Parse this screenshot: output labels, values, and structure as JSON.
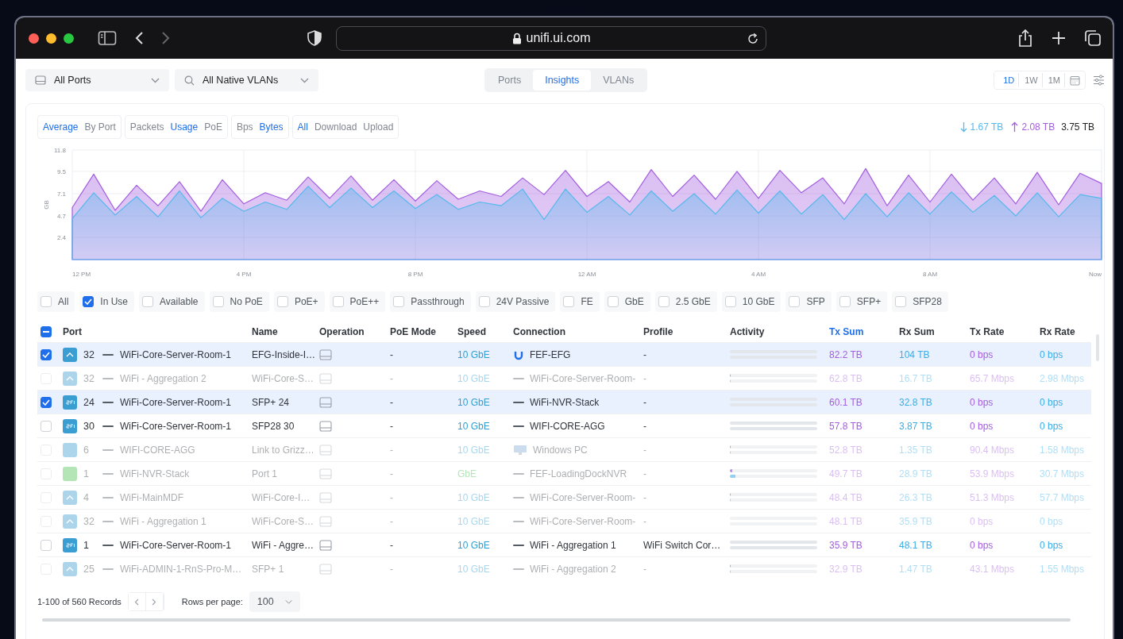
{
  "browser": {
    "url": "unifi.ui.com"
  },
  "filters": {
    "ports": "All Ports",
    "vlans": "All Native VLANs"
  },
  "view_tabs": [
    {
      "label": "Ports",
      "selected": false
    },
    {
      "label": "Insights",
      "selected": true
    },
    {
      "label": "VLANs",
      "selected": false
    }
  ],
  "ranges": [
    {
      "label": "1D",
      "selected": true
    },
    {
      "label": "1W",
      "selected": false
    },
    {
      "label": "1M",
      "selected": false
    }
  ],
  "toggle_groups": [
    {
      "options": [
        {
          "label": "Average",
          "selected": true
        },
        {
          "label": "By Port",
          "selected": false
        }
      ]
    },
    {
      "options": [
        {
          "label": "Packets",
          "selected": false
        },
        {
          "label": "Usage",
          "selected": true
        },
        {
          "label": "PoE",
          "selected": false
        }
      ]
    },
    {
      "options": [
        {
          "label": "Bps",
          "selected": false
        },
        {
          "label": "Bytes",
          "selected": true
        }
      ]
    },
    {
      "options": [
        {
          "label": "All",
          "selected": true
        },
        {
          "label": "Download",
          "selected": false
        },
        {
          "label": "Upload",
          "selected": false
        }
      ]
    }
  ],
  "totals": {
    "download": "1.67 TB",
    "upload": "2.08 TB",
    "total": "3.75 TB"
  },
  "chart_data": {
    "type": "area",
    "ylabel": "GB",
    "stacked": false,
    "grid": true,
    "ylim": [
      0,
      11.8
    ],
    "yticks": [
      2.4,
      4.7,
      7.1,
      9.5,
      11.8
    ],
    "categories": [
      "12 PM",
      null,
      null,
      null,
      null,
      null,
      null,
      null,
      "4 PM",
      null,
      null,
      null,
      null,
      null,
      null,
      null,
      "8 PM",
      null,
      null,
      null,
      null,
      null,
      null,
      null,
      "12 AM",
      null,
      null,
      null,
      null,
      null,
      null,
      null,
      "4 AM",
      null,
      null,
      null,
      null,
      null,
      null,
      null,
      "8 AM",
      null,
      null,
      null,
      null,
      null,
      null,
      null,
      "Now"
    ],
    "series": [
      {
        "color": "#56b9ec",
        "values": [
          4.4,
          7.2,
          4.8,
          6.8,
          4.6,
          7.4,
          4.5,
          6.6,
          5.2,
          6.2,
          5.4,
          7.9,
          5.6,
          7.7,
          5.6,
          7.4,
          5.5,
          7.0,
          5.4,
          6.2,
          5.8,
          7.6,
          4.3,
          7.6,
          5.1,
          6.8,
          4.8,
          7.4,
          5.2,
          7.1,
          4.9,
          7.5,
          5.0,
          7.4,
          4.9,
          7.0,
          4.3,
          7.1,
          4.6,
          7.2,
          4.9,
          7.3,
          5.1,
          6.9,
          4.7,
          7.2,
          4.6,
          7.0,
          6.6
        ]
      },
      {
        "color": "#a35ee0",
        "values": [
          5.6,
          9.2,
          5.3,
          8.0,
          5.8,
          8.4,
          5.2,
          8.6,
          6.0,
          7.2,
          6.4,
          8.9,
          6.6,
          9.0,
          6.4,
          8.6,
          6.3,
          8.5,
          6.5,
          7.4,
          6.8,
          8.8,
          7.0,
          9.6,
          6.8,
          8.4,
          6.2,
          9.7,
          6.8,
          9.1,
          6.5,
          9.5,
          6.6,
          9.6,
          7.2,
          8.8,
          6.0,
          9.8,
          5.8,
          9.1,
          6.2,
          9.2,
          6.4,
          8.8,
          6.0,
          9.4,
          5.9,
          9.3,
          8.2
        ]
      }
    ]
  },
  "port_filters": [
    {
      "label": "All",
      "checked": false
    },
    {
      "label": "In Use",
      "checked": true
    },
    {
      "label": "Available",
      "checked": false
    },
    {
      "label": "No PoE",
      "checked": false
    },
    {
      "label": "PoE+",
      "checked": false
    },
    {
      "label": "PoE++",
      "checked": false
    },
    {
      "label": "Passthrough",
      "checked": false
    },
    {
      "label": "24V Passive",
      "checked": false
    },
    {
      "label": "FE",
      "checked": false
    },
    {
      "label": "GbE",
      "checked": false
    },
    {
      "label": "2.5 GbE",
      "checked": false
    },
    {
      "label": "10 GbE",
      "checked": false
    },
    {
      "label": "SFP",
      "checked": false
    },
    {
      "label": "SFP+",
      "checked": false
    },
    {
      "label": "SFP28",
      "checked": false
    }
  ],
  "table": {
    "select_all": {
      "indeterminate": true
    },
    "columns": [
      {
        "label": "Port",
        "sorted": false
      },
      {
        "label": "Name",
        "sorted": false
      },
      {
        "label": "Operation",
        "sorted": false
      },
      {
        "label": "PoE Mode",
        "sorted": false
      },
      {
        "label": "Speed",
        "sorted": false
      },
      {
        "label": "Connection",
        "sorted": false
      },
      {
        "label": "Profile",
        "sorted": false
      },
      {
        "label": "Activity",
        "sorted": false
      },
      {
        "label": "Tx Sum",
        "sorted": true
      },
      {
        "label": "Rx Sum",
        "sorted": false
      },
      {
        "label": "Tx Rate",
        "sorted": false
      },
      {
        "label": "Rx Rate",
        "sorted": false
      }
    ],
    "rows": [
      {
        "selected": true,
        "disabled": false,
        "port_icon": {
          "kind": "uplink",
          "color": "#3b9ed3"
        },
        "port": "32",
        "device": "WiFi-Core-Server-Room-1",
        "name": "EFG-Inside-I…",
        "poe_mode": "-",
        "speed": {
          "label": "10 GbE",
          "color": "#2f9fd3"
        },
        "connection": {
          "kind": "logo",
          "label": "FEF-EFG"
        },
        "profile": "-",
        "activity": [
          {
            "level": 0
          },
          {
            "level": 0
          }
        ],
        "tx_sum": "82.2 TB",
        "rx_sum": "104 TB",
        "tx_rate": "0 bps",
        "rx_rate": "0 bps"
      },
      {
        "selected": false,
        "disabled": true,
        "port_icon": {
          "kind": "uplink",
          "color": "#acd5ec"
        },
        "port": "32",
        "device": "WiFi - Aggregation 2",
        "name": "WiFi-Core-S…",
        "poe_mode": "-",
        "speed": {
          "label": "10 GbE",
          "color": "#a9d7ee"
        },
        "connection": {
          "kind": "cable",
          "label": "WiFi-Core-Server-Room-"
        },
        "profile": "-",
        "activity": [
          {
            "level": 0.01
          },
          {
            "level": 0.01
          }
        ],
        "tx_sum": "62.8 TB",
        "rx_sum": "16.7 TB",
        "tx_rate": "65.7 Mbps",
        "rx_rate": "2.98 Mbps"
      },
      {
        "selected": true,
        "disabled": false,
        "port_icon": {
          "kind": "sfp",
          "color": "#3b9ed3"
        },
        "port": "24",
        "device": "WiFi-Core-Server-Room-1",
        "name": "SFP+ 24",
        "poe_mode": "-",
        "speed": {
          "label": "10 GbE",
          "color": "#2f9fd3"
        },
        "connection": {
          "kind": "cable",
          "label": "WiFi-NVR-Stack"
        },
        "profile": "-",
        "activity": [
          {
            "level": 0
          },
          {
            "level": 0
          }
        ],
        "tx_sum": "60.1 TB",
        "rx_sum": "32.8 TB",
        "tx_rate": "0 bps",
        "rx_rate": "0 bps"
      },
      {
        "selected": false,
        "disabled": false,
        "port_icon": {
          "kind": "sfp",
          "color": "#3b9ed3"
        },
        "port": "30",
        "device": "WiFi-Core-Server-Room-1",
        "name": "SFP28 30",
        "poe_mode": "-",
        "speed": {
          "label": "10 GbE",
          "color": "#2f9fd3"
        },
        "connection": {
          "kind": "cable",
          "label": "WIFI-CORE-AGG"
        },
        "profile": "-",
        "activity": [
          {
            "level": 0
          },
          {
            "level": 0
          }
        ],
        "tx_sum": "57.8 TB",
        "rx_sum": "3.87 TB",
        "tx_rate": "0 bps",
        "rx_rate": "0 bps"
      },
      {
        "selected": false,
        "disabled": true,
        "port_icon": {
          "kind": "plain",
          "color": "#acd5ec"
        },
        "port": "6",
        "device": "WIFI-CORE-AGG",
        "name": "Link to Grizz…",
        "poe_mode": "-",
        "speed": {
          "label": "10 GbE",
          "color": "#a9d7ee"
        },
        "connection": {
          "kind": "pc",
          "label": "Windows PC"
        },
        "profile": "-",
        "activity": [
          {
            "level": 0.01
          },
          {
            "level": 0.01
          }
        ],
        "tx_sum": "52.8 TB",
        "rx_sum": "1.35 TB",
        "tx_rate": "90.4 Mbps",
        "rx_rate": "1.58 Mbps"
      },
      {
        "selected": false,
        "disabled": true,
        "port_icon": {
          "kind": "plain",
          "color": "#b4e5b7"
        },
        "port": "1",
        "device": "WiFi-NVR-Stack",
        "name": "Port 1",
        "poe_mode": "-",
        "speed": {
          "label": "GbE",
          "color": "#b5e6ba"
        },
        "connection": {
          "kind": "cable",
          "label": "FEF-LoadingDockNVR"
        },
        "profile": "-",
        "activity": [
          {
            "level": 0.03
          },
          {
            "level": 0.06
          }
        ],
        "tx_sum": "49.7 TB",
        "rx_sum": "28.9 TB",
        "tx_rate": "53.9 Mbps",
        "rx_rate": "30.7 Mbps"
      },
      {
        "selected": false,
        "disabled": true,
        "port_icon": {
          "kind": "uplink",
          "color": "#acd5ec"
        },
        "port": "4",
        "device": "WiFi-MainMDF",
        "name": "WiFi-Core-I…",
        "poe_mode": "-",
        "speed": {
          "label": "10 GbE",
          "color": "#a9d7ee"
        },
        "connection": {
          "kind": "cable",
          "label": "WiFi-Core-Server-Room-"
        },
        "profile": "-",
        "activity": [
          {
            "level": 0.01
          },
          {
            "level": 0.01
          }
        ],
        "tx_sum": "48.4 TB",
        "rx_sum": "26.3 TB",
        "tx_rate": "51.3 Mbps",
        "rx_rate": "57.7 Mbps"
      },
      {
        "selected": false,
        "disabled": true,
        "port_icon": {
          "kind": "uplink",
          "color": "#acd5ec"
        },
        "port": "32",
        "device": "WiFi - Aggregation 1",
        "name": "WiFi-Core-S…",
        "poe_mode": "-",
        "speed": {
          "label": "10 GbE",
          "color": "#a9d7ee"
        },
        "connection": {
          "kind": "cable",
          "label": "WiFi-Core-Server-Room-"
        },
        "profile": "-",
        "activity": [
          {
            "level": 0
          },
          {
            "level": 0
          }
        ],
        "tx_sum": "48.1 TB",
        "rx_sum": "35.9 TB",
        "tx_rate": "0 bps",
        "rx_rate": "0 bps"
      },
      {
        "selected": false,
        "disabled": false,
        "port_icon": {
          "kind": "sfp",
          "color": "#3b9ed3"
        },
        "port": "1",
        "device": "WiFi-Core-Server-Room-1",
        "name": "WiFi - Aggre…",
        "poe_mode": "-",
        "speed": {
          "label": "10 GbE",
          "color": "#2f9fd3"
        },
        "connection": {
          "kind": "cable",
          "label": "WiFi - Aggregation 1"
        },
        "profile": "WiFi Switch Cor…",
        "activity": [
          {
            "level": 0
          },
          {
            "level": 0
          }
        ],
        "tx_sum": "35.9 TB",
        "rx_sum": "48.1 TB",
        "tx_rate": "0 bps",
        "rx_rate": "0 bps"
      },
      {
        "selected": false,
        "disabled": true,
        "port_icon": {
          "kind": "uplink",
          "color": "#acd5ec"
        },
        "port": "25",
        "device": "WiFi-ADMIN-1-RnS-Pro-M…",
        "name": "SFP+ 1",
        "poe_mode": "-",
        "speed": {
          "label": "10 GbE",
          "color": "#a9d7ee"
        },
        "connection": {
          "kind": "cable",
          "label": "WiFi - Aggregation 2"
        },
        "profile": "-",
        "activity": [
          {
            "level": 0.01
          },
          {
            "level": 0.01
          }
        ],
        "tx_sum": "32.9 TB",
        "rx_sum": "1.47 TB",
        "tx_rate": "43.1 Mbps",
        "rx_rate": "1.55 Mbps"
      }
    ]
  },
  "pagination": {
    "records": "1-100 of 560 Records",
    "rows_per_page_label": "Rows per page:",
    "rows_per_page": "100"
  }
}
